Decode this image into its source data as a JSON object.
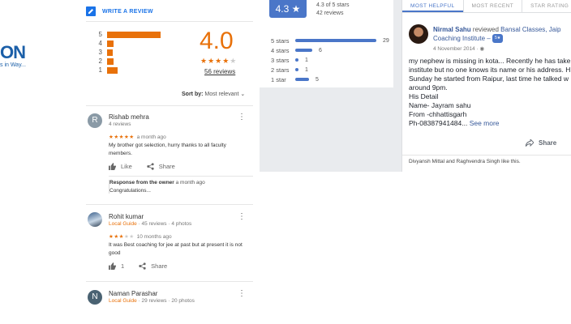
{
  "logo": {
    "text": "ON",
    "tagline": "s in Way..."
  },
  "google_reviews": {
    "write_review": "WRITE A REVIEW",
    "histogram": [
      {
        "label": "5",
        "fraction": 1.0
      },
      {
        "label": "4",
        "fraction": 0.12
      },
      {
        "label": "3",
        "fraction": 0.1
      },
      {
        "label": "2",
        "fraction": 0.12
      },
      {
        "label": "1",
        "fraction": 0.2
      }
    ],
    "rating": "4.0",
    "stars": "★★★★★",
    "star_value": 4,
    "count": "56 reviews",
    "sort_label": "Sort by:",
    "sort_value": "Most relevant",
    "reviews": [
      {
        "initial": "R",
        "name": "Rishab mehra",
        "meta": "4 reviews",
        "stars": "★★★★★",
        "empty": "",
        "ago": "a month ago",
        "text": "My brother got selection, hurry thanks to all faculty members.",
        "like": "Like",
        "share": "Share",
        "owner_label": "Response from the owner",
        "owner_ago": "a month ago",
        "owner_text": "Congratulations..."
      },
      {
        "name": "Rohit kumar",
        "guide": "Local Guide",
        "meta": "· 45 reviews · 4 photos",
        "stars": "★★★",
        "empty": "★★",
        "ago": "10 months ago",
        "text": "It was Best coaching for jee at past but at present it is not good",
        "like": "1",
        "share": "Share"
      },
      {
        "initial": "N",
        "name": "Naman Parashar",
        "guide": "Local Guide",
        "meta": "· 29 reviews · 20 photos"
      }
    ]
  },
  "fb_rating": {
    "badge": "4.3 ★",
    "summary_line1": "4.3 of 5 stars",
    "summary_line2": "42 reviews",
    "rows": [
      {
        "label": "5 stars",
        "count": "29",
        "fraction": 1.0
      },
      {
        "label": "4 stars",
        "count": "6",
        "fraction": 0.21
      },
      {
        "label": "3 stars",
        "count": "1",
        "fraction": 0.035
      },
      {
        "label": "2 stars",
        "count": "1",
        "fraction": 0.035
      },
      {
        "label": "1 star",
        "count": "5",
        "fraction": 0.17
      }
    ]
  },
  "fb_review": {
    "tabs": [
      "MOST HELPFUL",
      "MOST RECENT",
      "STAR RATING"
    ],
    "author": "Nirmal Sahu",
    "verb": "reviewed",
    "page": "Bansal Classes, Jaip",
    "page2": "Coaching Institute –",
    "tag": "5★",
    "date": "4 November 2014 ·",
    "body_lines": [
      "my nephew is missing in kota... Recently he has take",
      "institute but no one knows its name or his address. H",
      "Sunday he started from Raipur, last time he talked w",
      "around 9pm.",
      "His Detail",
      "Name- Jayram sahu",
      "From -chhattisgarh"
    ],
    "last_line": "Ph-08387941484...",
    "see_more": "See more",
    "share": "Share",
    "likes": "Divyansh Mittal and Raghvendra Singh like this."
  }
}
